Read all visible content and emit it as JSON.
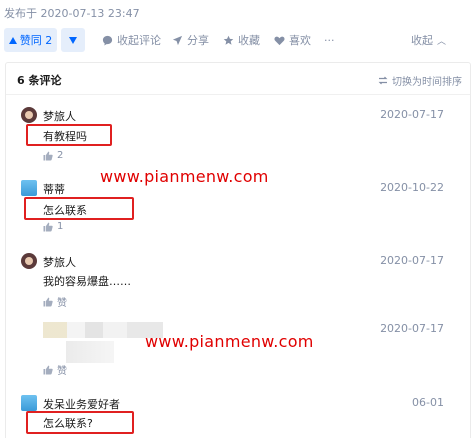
{
  "header": {
    "posted_at": "发布于 2020-07-13 23:47"
  },
  "actions": {
    "vote_label": "赞同 2",
    "collapse_comments": "收起评论",
    "share": "分享",
    "favorite": "收藏",
    "like": "喜欢",
    "more": "···",
    "fold": "收起"
  },
  "comments_panel": {
    "count_label": "6 条评论",
    "sort_label": "切换为时间排序"
  },
  "comments": [
    {
      "user": "梦旅人",
      "date": "2020-07-17",
      "text": "有教程吗",
      "likes": "2"
    },
    {
      "user": "蒂蒂",
      "date": "2020-10-22",
      "text": "怎么联系",
      "likes": "1"
    },
    {
      "user": "梦旅人",
      "date": "2020-07-17",
      "text": "我的容易爆盘……",
      "likes": "赞"
    },
    {
      "user": "",
      "date": "2020-07-17",
      "text": "",
      "likes": "赞"
    },
    {
      "user": "发呆业务爱好者",
      "date": "06-01",
      "text": "怎么联系?",
      "likes": ""
    }
  ],
  "watermarks": {
    "first": "www.pianmenw.com",
    "second": "www.pianmenw.com"
  },
  "colors": {
    "accent": "#0066ff",
    "highlight": "#e02020",
    "watermark": "#e00000"
  }
}
